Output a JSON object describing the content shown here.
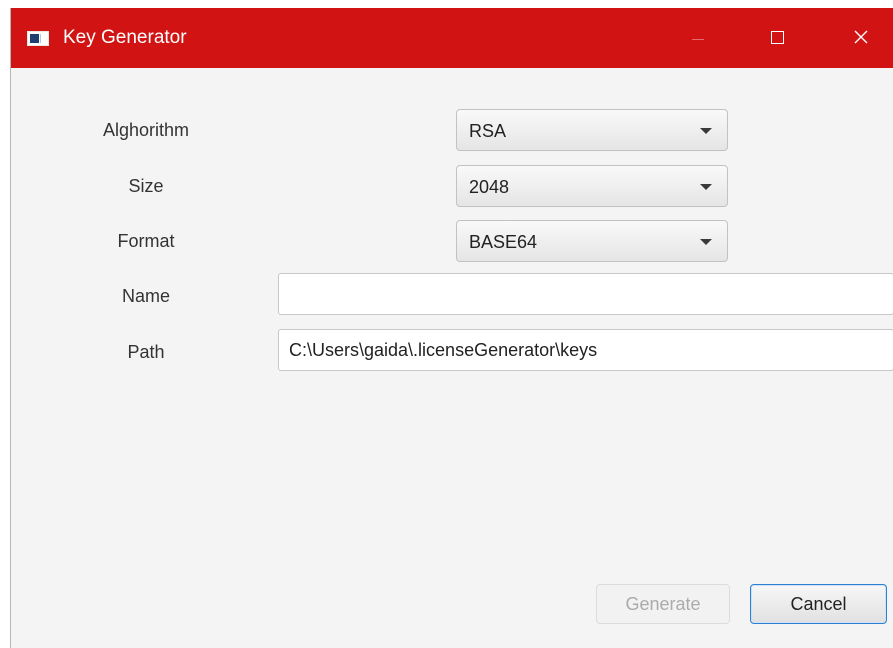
{
  "window": {
    "title": "Key Generator",
    "accent_color": "#d11313",
    "controls": [
      "minimize-icon",
      "maximize-icon",
      "close-icon"
    ]
  },
  "form": {
    "algorithm": {
      "label": "Alghorithm",
      "value": "RSA"
    },
    "size": {
      "label": "Size",
      "value": "2048"
    },
    "format": {
      "label": "Format",
      "value": "BASE64"
    },
    "name": {
      "label": "Name",
      "value": ""
    },
    "path": {
      "label": "Path",
      "value": "C:\\Users\\gaida\\.licenseGenerator\\keys"
    }
  },
  "buttons": {
    "generate": "Generate",
    "generate_disabled": true,
    "cancel": "Cancel"
  }
}
